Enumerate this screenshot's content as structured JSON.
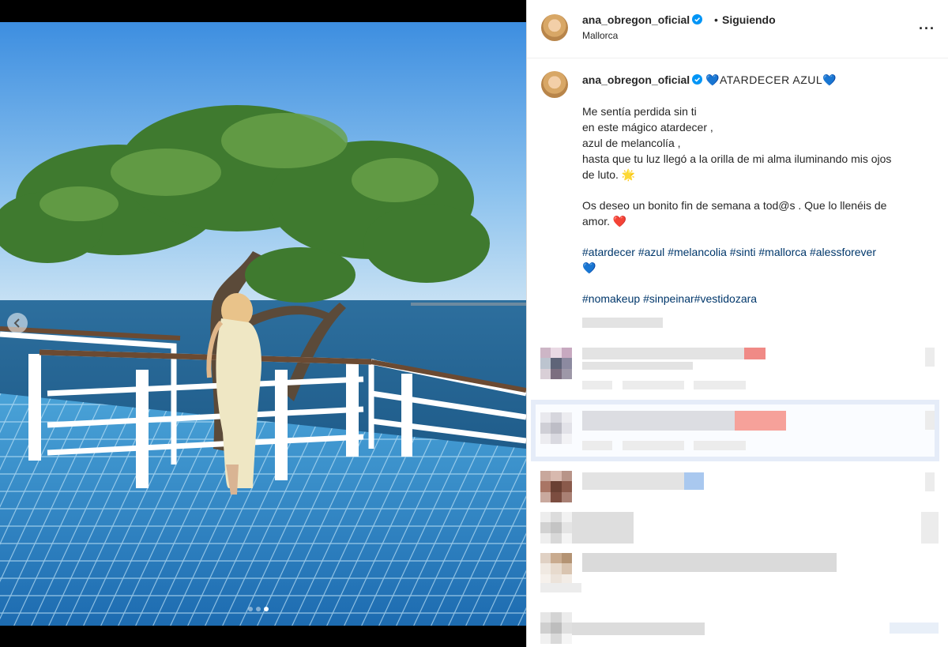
{
  "post": {
    "username": "ana_obregon_oficial",
    "location": "Mallorca",
    "follow_state": "Siguiendo",
    "separator": "•",
    "more_icon": "more-horizontal-icon"
  },
  "caption": {
    "username": "ana_obregon_oficial",
    "title": "💙ATARDECER AZUL💙",
    "lines": [
      "Me sentía perdida sin ti",
      "en este mágico atardecer ,",
      "azul de melancolía ,",
      "hasta que tu luz llegó a la orilla de mi alma iluminando mis ojos",
      "de luto. 🌟"
    ],
    "wish_line1": "Os deseo un bonito fin de semana a tod@s . Que lo llenéis de",
    "wish_line2": "amor. ❤️",
    "hashtags_line1": [
      "#atardecer",
      "#azul",
      "#melancolia",
      "#sinti",
      "#mallorca",
      "#alessforever"
    ],
    "hashtags_line1_tail": "💙",
    "hashtags_line2": [
      "#nomakeup",
      "#sinpeinar",
      "#vestidozara"
    ]
  },
  "carousel": {
    "slides": 3,
    "active_index": 2
  },
  "colors": {
    "hashtag": "#00376b",
    "verified": "#0095f6",
    "text": "#262626"
  }
}
